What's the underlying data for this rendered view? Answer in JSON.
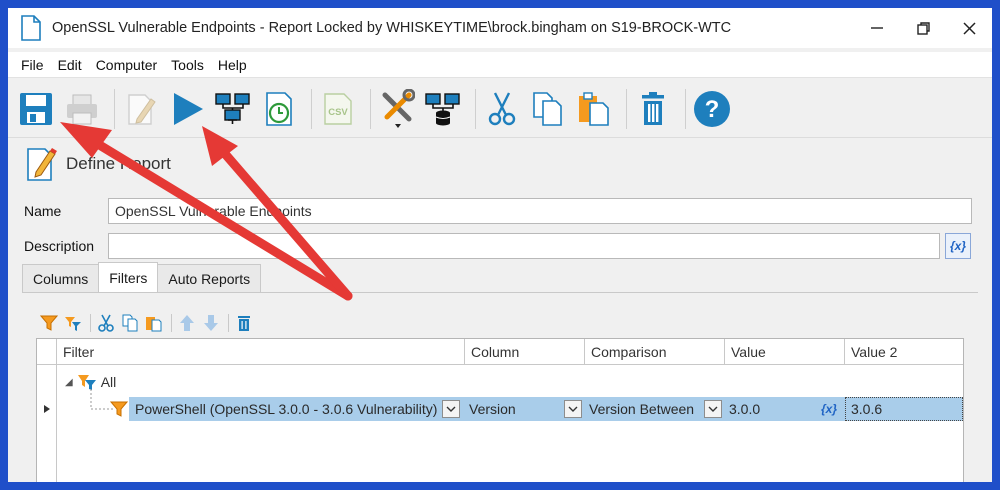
{
  "window": {
    "title": "OpenSSL Vulnerable Endpoints - Report Locked by WHISKEYTIME\\brock.bingham on S19-BROCK-WTC",
    "controls": [
      "minimize-icon",
      "maximize-icon",
      "close-icon"
    ]
  },
  "menu": [
    "File",
    "Edit",
    "Computer",
    "Tools",
    "Help"
  ],
  "toolbar": {
    "icons": [
      "save-icon",
      "print-icon",
      "edit-icon",
      "run-icon",
      "computers-icon",
      "schedule-icon",
      "csv-icon",
      "tools-icon",
      "database-computers-icon",
      "cut-icon",
      "copy-icon",
      "paste-icon",
      "delete-icon",
      "help-icon"
    ],
    "csv_label": "CSV"
  },
  "define_report": {
    "heading": "Define Report"
  },
  "form": {
    "name_label": "Name",
    "name_value": "OpenSSL Vulnerable Endpoints",
    "description_label": "Description",
    "description_value": "",
    "fx_label": "{x}"
  },
  "tabs": [
    {
      "label": "Columns",
      "active": false
    },
    {
      "label": "Filters",
      "active": true
    },
    {
      "label": "Auto Reports",
      "active": false
    }
  ],
  "grid": {
    "headers": [
      "Filter",
      "Column",
      "Comparison",
      "Value",
      "Value 2"
    ],
    "root": {
      "label": "All",
      "expand": "◢"
    },
    "row": {
      "filter": "PowerShell (OpenSSL 3.0.0 - 3.0.6 Vulnerability)",
      "column": "Version",
      "comparison": "Version Between",
      "value": "3.0.0",
      "value2": "3.0.6",
      "fx": "{x}"
    }
  },
  "colors": {
    "border": "#1f4fc9",
    "accent": "#1e7fbd",
    "selection": "#a9cdea",
    "arrow": "#e53935"
  }
}
